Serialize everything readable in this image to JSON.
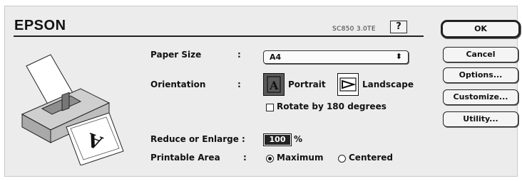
{
  "header": {
    "brand": "EPSON",
    "model": "SC850 3.0TE",
    "help_label": "?"
  },
  "paper_size": {
    "label": "Paper Size",
    "colon": ":",
    "selected": "A4",
    "arrows": "⬍"
  },
  "orientation": {
    "label": "Orientation",
    "colon": ":",
    "portrait_label": "Portrait",
    "landscape_label": "Landscape",
    "selected": "Portrait"
  },
  "rotate": {
    "label": "Rotate by 180 degrees",
    "checked": false
  },
  "reduce": {
    "label": "Reduce or Enlarge :",
    "value": "100",
    "unit": "%"
  },
  "printable_area": {
    "label": "Printable Area",
    "colon": ":",
    "options": [
      "Maximum",
      "Centered"
    ],
    "selected": "Maximum"
  },
  "buttons": {
    "ok": "OK",
    "cancel": "Cancel",
    "options": "Options...",
    "customize": "Customize...",
    "utility": "Utility..."
  },
  "icons": {
    "help": "help-icon",
    "printer": "printer-icon",
    "portrait": "portrait-orientation-icon",
    "landscape": "landscape-orientation-icon"
  }
}
